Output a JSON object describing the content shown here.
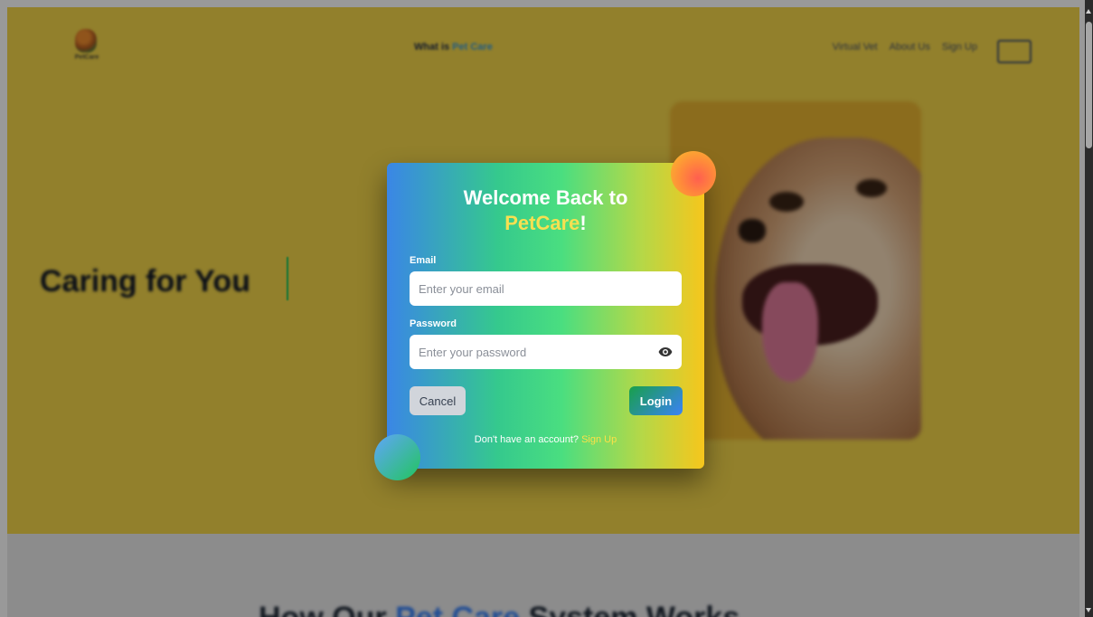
{
  "nav": {
    "logo_text": "PetCare",
    "center_prefix": "What is ",
    "center_accent": "Pet Care",
    "links": [
      "Virtual Vet",
      "About Us",
      "Sign Up"
    ]
  },
  "hero": {
    "title": "Caring for You"
  },
  "below": {
    "title_prefix": "How Our ",
    "title_accent": "Pet Care",
    "title_suffix": " System Works"
  },
  "modal": {
    "title_line1": "Welcome Back to",
    "title_brand": "PetCare",
    "title_bang": "!",
    "email_label": "Email",
    "email_placeholder": "Enter your email",
    "password_label": "Password",
    "password_placeholder": "Enter your password",
    "cancel_label": "Cancel",
    "login_label": "Login",
    "signup_prompt": "Don't have an account? ",
    "signup_link": "Sign Up"
  },
  "icons": {
    "password_toggle": "eye-icon"
  },
  "colors": {
    "hero_bg": "#f3d54a",
    "brand_yellow": "#f7e051",
    "link_yellow": "#fde047",
    "accent_blue": "#3a9bd8"
  }
}
